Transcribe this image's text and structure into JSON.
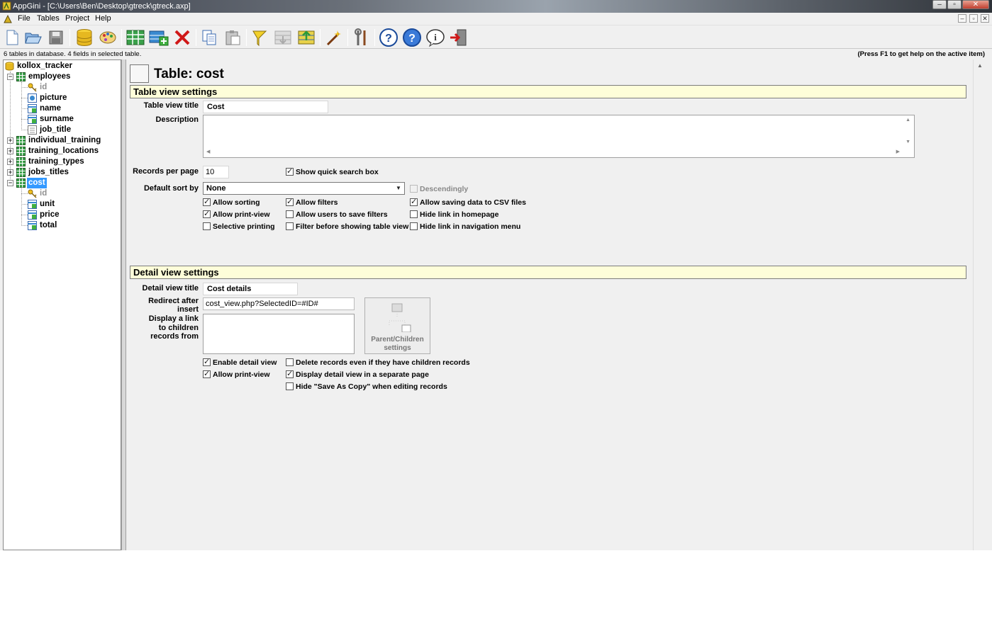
{
  "window": {
    "title": "AppGini - [C:\\Users\\Ben\\Desktop\\gtreck\\gtreck.axp]",
    "controls": {
      "minimize": "–",
      "maximize": "▫",
      "close": "✕"
    }
  },
  "menu": {
    "items": [
      "File",
      "Tables",
      "Project",
      "Help"
    ],
    "mdi_controls": [
      "–",
      "▫",
      "✕"
    ]
  },
  "toolbar": {
    "buttons": [
      "new-project-icon",
      "open-project-icon",
      "save-project-icon",
      "database-icon",
      "theme-icon",
      "new-table-icon",
      "new-field-icon",
      "delete-icon",
      "copy-icon",
      "paste-icon",
      "highlight-icon",
      "move-down-icon",
      "move-up-icon",
      "wizard-icon",
      "tools-icon",
      "help-icon",
      "help-topics-icon",
      "info-icon",
      "exit-icon"
    ]
  },
  "status": {
    "left": "6 tables in database. 4 fields in selected table.",
    "right": "(Press F1 to get help on the active item)"
  },
  "tree": {
    "database": "kollox_tracker",
    "tables": [
      {
        "name": "employees",
        "expanded": true,
        "fields": [
          "id",
          "picture",
          "name",
          "surname",
          "job_title"
        ]
      },
      {
        "name": "individual_training",
        "expanded": false
      },
      {
        "name": "training_locations",
        "expanded": false
      },
      {
        "name": "training_types",
        "expanded": false
      },
      {
        "name": "jobs_titles",
        "expanded": false
      },
      {
        "name": "cost",
        "expanded": true,
        "selected": true,
        "fields": [
          "id",
          "unit",
          "price",
          "total"
        ]
      }
    ]
  },
  "page": {
    "title": "Table: cost"
  },
  "table_view": {
    "section_title": "Table view settings",
    "title_label": "Table view title",
    "title_value": "Cost",
    "description_label": "Description",
    "description_value": "",
    "records_label": "Records per page",
    "records_value": "10",
    "show_quick_search": {
      "label": "Show quick search box",
      "checked": true
    },
    "sort_label": "Default sort by",
    "sort_value": "None",
    "descendingly": {
      "label": "Descendingly",
      "checked": false,
      "disabled": true
    },
    "options": [
      {
        "label": "Allow sorting",
        "checked": true
      },
      {
        "label": "Allow filters",
        "checked": true
      },
      {
        "label": "Allow saving data to CSV files",
        "checked": true
      },
      {
        "label": "Allow print-view",
        "checked": true
      },
      {
        "label": "Allow users to save filters",
        "checked": false
      },
      {
        "label": "Hide link in homepage",
        "checked": false
      },
      {
        "label": "Selective printing",
        "checked": false
      },
      {
        "label": "Filter before showing table view",
        "checked": false
      },
      {
        "label": "Hide link in navigation menu",
        "checked": false
      }
    ]
  },
  "detail_view": {
    "section_title": "Detail view settings",
    "title_label": "Detail view title",
    "title_value": "Cost details",
    "redirect_label": "Redirect after insert",
    "redirect_value": "cost_view.php?SelectedID=#ID#",
    "display_link_label_1": "Display a link",
    "display_link_label_2": "to children",
    "display_link_label_3": "records from",
    "parent_children_label_1": "Parent/Children",
    "parent_children_label_2": "settings",
    "options": [
      {
        "label": "Enable detail view",
        "checked": true
      },
      {
        "label": "Delete records even if they have children records",
        "checked": false
      },
      {
        "label": "Allow print-view",
        "checked": true
      },
      {
        "label": "Display detail view in a separate page",
        "checked": true
      },
      {
        "label": "Hide \"Save As Copy\" when editing records",
        "checked": false
      }
    ]
  },
  "colors": {
    "section_bg": "#fefed9",
    "selection": "#3399ff",
    "window_bg": "#f0f0f0"
  }
}
